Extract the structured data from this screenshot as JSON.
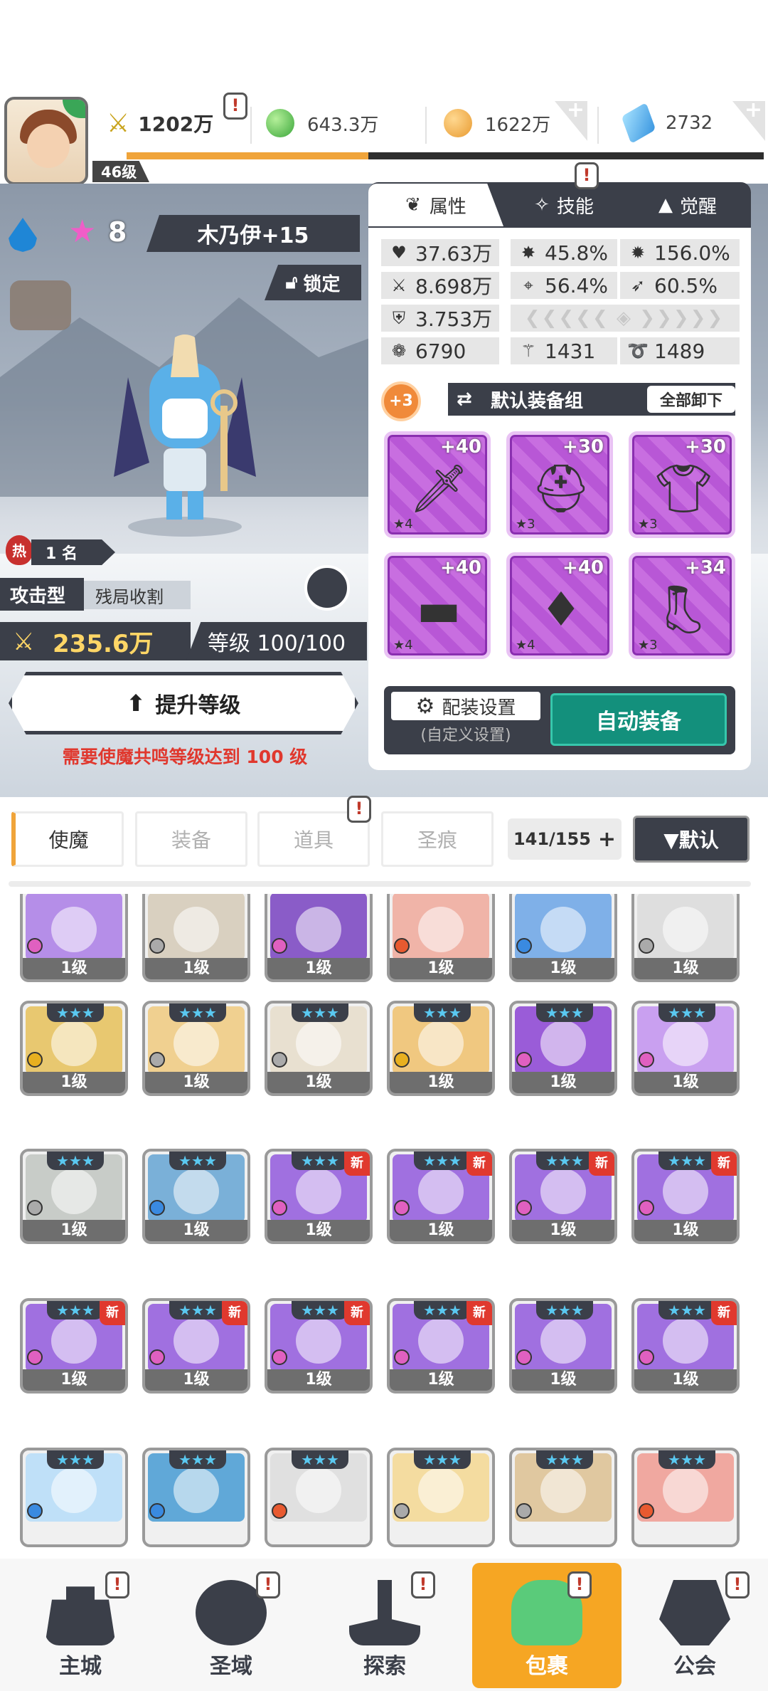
{
  "resources": {
    "power": "1202万",
    "gem_green": "643.3万",
    "gold": "1622万",
    "diamond": "2732",
    "player_level": "46级",
    "exp_progress": 0.38
  },
  "hero": {
    "stars": "8",
    "name": "木乃伊+15",
    "lock_label": "锁定",
    "hot_badge": "热",
    "rank": "1 名",
    "type": "攻击型",
    "skill": "残局收割",
    "power": "235.6万",
    "level": "等级 100/100",
    "upgrade_label": "提升等级",
    "warning": "需要使魔共鸣等级达到 100 级"
  },
  "panel": {
    "tabs": [
      {
        "label": "属性"
      },
      {
        "label": "技能"
      },
      {
        "label": "觉醒"
      }
    ],
    "stats": [
      {
        "icon": "heart-icon",
        "value": "37.63万"
      },
      {
        "icon": "burst-icon",
        "value": "45.8%"
      },
      {
        "icon": "gear-burst-icon",
        "value": "156.0%"
      },
      {
        "icon": "sword-icon",
        "value": "8.698万"
      },
      {
        "icon": "target-icon",
        "value": "56.4%"
      },
      {
        "icon": "dodge-icon",
        "value": "60.5%"
      },
      {
        "icon": "shield-icon",
        "value": "3.753万"
      },
      {
        "icon": "swirl-icon",
        "value": "6790"
      },
      {
        "icon": "slash-icon",
        "value": "1431"
      },
      {
        "icon": "spiral-icon",
        "value": "1489"
      }
    ],
    "equip_bonus": "+3",
    "equip_group": "默认装备组",
    "unequip_all": "全部卸下",
    "equipment": [
      {
        "name": "sword",
        "plus": "+40",
        "stars": "★4"
      },
      {
        "name": "helmet",
        "plus": "+30",
        "stars": "★3"
      },
      {
        "name": "armor",
        "plus": "+30",
        "stars": "★3"
      },
      {
        "name": "belt",
        "plus": "+40",
        "stars": "★4"
      },
      {
        "name": "necklace",
        "plus": "+40",
        "stars": "★4"
      },
      {
        "name": "boots",
        "plus": "+34",
        "stars": "★3"
      }
    ],
    "config_label": "配装设置",
    "config_sub": "(自定义设置)",
    "auto_equip": "自动装备"
  },
  "categories": {
    "items": [
      {
        "label": "使魔"
      },
      {
        "label": "装备"
      },
      {
        "label": "道具"
      },
      {
        "label": "圣痕"
      }
    ],
    "count": "141/155",
    "sort": "▼默认"
  },
  "grid": {
    "level_label": "1级",
    "new_label": "新",
    "star_text": "★★★",
    "rows": [
      [
        {
          "c": "#b58ee8",
          "e": "#e060c0"
        },
        {
          "c": "#d9d0c0",
          "e": "#aaa"
        },
        {
          "c": "#8a5cc8",
          "e": "#e060c0"
        },
        {
          "c": "#f0b4a8",
          "e": "#e85a30"
        },
        {
          "c": "#7fb0e8",
          "e": "#3a8ae0"
        },
        {
          "c": "#dedede",
          "e": "#aaa"
        }
      ],
      [
        {
          "c": "#e8c870",
          "e": "#e8b020"
        },
        {
          "c": "#f0d090",
          "e": "#aaa"
        },
        {
          "c": "#e8e0d0",
          "e": "#aaa"
        },
        {
          "c": "#f0c880",
          "e": "#e8b020"
        },
        {
          "c": "#9a5cd8",
          "e": "#e060c0"
        },
        {
          "c": "#c9a0f0",
          "e": "#e060c0"
        }
      ],
      [
        {
          "c": "#c8ccc8",
          "e": "#aaa"
        },
        {
          "c": "#7ab0d8",
          "e": "#3a8ae0"
        },
        {
          "c": "#a070e0",
          "e": "#e060c0",
          "n": 1
        },
        {
          "c": "#a070e0",
          "e": "#e060c0",
          "n": 1
        },
        {
          "c": "#a070e0",
          "e": "#e060c0",
          "n": 1
        },
        {
          "c": "#a070e0",
          "e": "#e060c0",
          "n": 1
        }
      ],
      [
        {
          "c": "#a070e0",
          "e": "#e060c0",
          "n": 1
        },
        {
          "c": "#a070e0",
          "e": "#e060c0",
          "n": 1
        },
        {
          "c": "#a070e0",
          "e": "#e060c0",
          "n": 1
        },
        {
          "c": "#a070e0",
          "e": "#e060c0",
          "n": 1
        },
        {
          "c": "#a070e0",
          "e": "#e060c0"
        },
        {
          "c": "#a070e0",
          "e": "#e060c0",
          "n": 1
        }
      ],
      [
        {
          "c": "#bfe0f8",
          "e": "#3a8ae0"
        },
        {
          "c": "#60a8d8",
          "e": "#3a8ae0"
        },
        {
          "c": "#e0e0e0",
          "e": "#e85a30"
        },
        {
          "c": "#f4dca0",
          "e": "#aaa"
        },
        {
          "c": "#e0c8a0",
          "e": "#aaa"
        },
        {
          "c": "#f0a8a0",
          "e": "#e85a30"
        }
      ]
    ]
  },
  "nav": [
    {
      "label": "主城",
      "icon": "castle-icon"
    },
    {
      "label": "圣域",
      "icon": "vortex-icon"
    },
    {
      "label": "探索",
      "icon": "sword-stone-icon"
    },
    {
      "label": "包裹",
      "icon": "backpack-icon",
      "active": true
    },
    {
      "label": "公会",
      "icon": "guild-helmet-icon"
    }
  ],
  "colors": {
    "accent": "#f0a43a",
    "dark": "#3b3f49",
    "teal": "#13907c",
    "warning": "#e0382e"
  }
}
